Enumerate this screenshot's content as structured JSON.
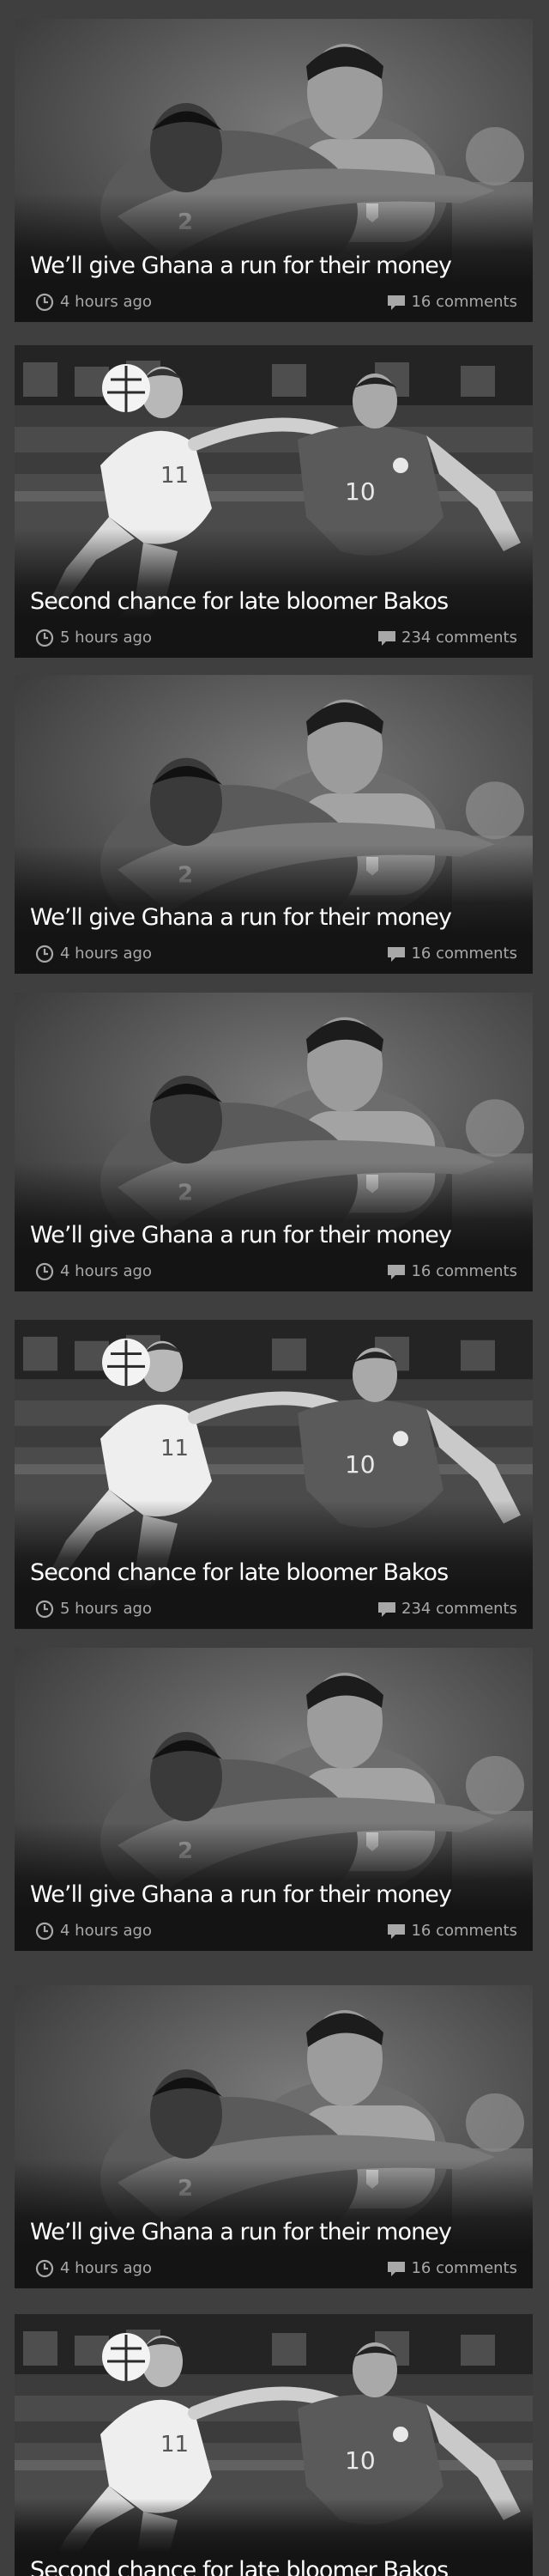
{
  "feed": {
    "articles": [
      {
        "title": "We’ll give Ghana a run for their money",
        "time": "4 hours ago",
        "comments": "16 comments",
        "image": "ghana-players-photo"
      },
      {
        "title": "Second chance for late bloomer Bakos",
        "time": "5 hours ago",
        "comments": "234 comments",
        "image": "bakos-players-photo"
      },
      {
        "title": "We’ll give Ghana a run for their money",
        "time": "4 hours ago",
        "comments": "16 comments",
        "image": "ghana-players-photo"
      },
      {
        "title": "We’ll give Ghana a run for their money",
        "time": "4 hours ago",
        "comments": "16 comments",
        "image": "ghana-players-photo"
      },
      {
        "title": "Second chance for late bloomer Bakos",
        "time": "5 hours ago",
        "comments": "234 comments",
        "image": "bakos-players-photo"
      },
      {
        "title": "We’ll give Ghana a run for their money",
        "time": "4 hours ago",
        "comments": "16 comments",
        "image": "ghana-players-photo"
      },
      {
        "title": "We’ll give Ghana a run for their money",
        "time": "4 hours ago",
        "comments": "16 comments",
        "image": "ghana-players-photo"
      },
      {
        "title": "Second chance for late bloomer Bakos",
        "image": "bakos-players-photo"
      }
    ],
    "icons": {
      "time": "clock-icon",
      "comments": "speech-bubble-icon"
    },
    "colors": {
      "page_background": "#3f3f3f",
      "card_background": "#161616",
      "title_text": "#ffffff",
      "meta_text": "#a8a8a8"
    }
  }
}
